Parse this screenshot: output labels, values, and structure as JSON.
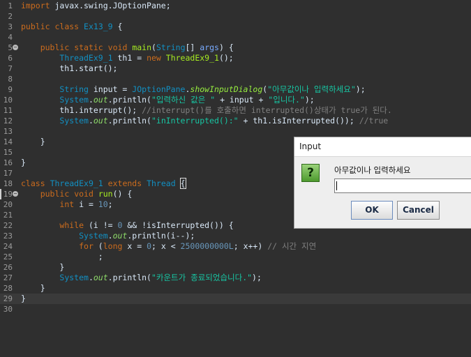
{
  "editor": {
    "lines": [
      {
        "n": "1",
        "parts": [
          {
            "t": "import",
            "c": "kw"
          },
          {
            "t": " javax.swing.JOptionPane;",
            "c": "plain"
          }
        ]
      },
      {
        "n": "2",
        "parts": []
      },
      {
        "n": "3",
        "parts": [
          {
            "t": "public",
            "c": "kw"
          },
          {
            "t": " ",
            "c": "plain"
          },
          {
            "t": "class",
            "c": "kw"
          },
          {
            "t": " ",
            "c": "plain"
          },
          {
            "t": "Ex13_9",
            "c": "cls"
          },
          {
            "t": " {",
            "c": "plain"
          }
        ]
      },
      {
        "n": "4",
        "parts": []
      },
      {
        "n": "5",
        "fold": true,
        "parts": [
          {
            "t": "    ",
            "c": "plain"
          },
          {
            "t": "public",
            "c": "kw"
          },
          {
            "t": " ",
            "c": "plain"
          },
          {
            "t": "static",
            "c": "kw"
          },
          {
            "t": " ",
            "c": "plain"
          },
          {
            "t": "void",
            "c": "kw"
          },
          {
            "t": " ",
            "c": "plain"
          },
          {
            "t": "main",
            "c": "fn"
          },
          {
            "t": "(",
            "c": "plain"
          },
          {
            "t": "String",
            "c": "ty"
          },
          {
            "t": "[] ",
            "c": "plain"
          },
          {
            "t": "args",
            "c": "param"
          },
          {
            "t": ") {",
            "c": "plain"
          }
        ]
      },
      {
        "n": "6",
        "parts": [
          {
            "t": "        ",
            "c": "plain"
          },
          {
            "t": "ThreadEx9_1",
            "c": "cls"
          },
          {
            "t": " ",
            "c": "plain"
          },
          {
            "t": "th1",
            "c": "plain"
          },
          {
            "t": " = ",
            "c": "plain"
          },
          {
            "t": "new",
            "c": "kw"
          },
          {
            "t": " ",
            "c": "plain"
          },
          {
            "t": "ThreadEx9_1",
            "c": "fn"
          },
          {
            "t": "();",
            "c": "plain"
          }
        ]
      },
      {
        "n": "7",
        "parts": [
          {
            "t": "        th1.start();",
            "c": "plain"
          }
        ]
      },
      {
        "n": "8",
        "parts": []
      },
      {
        "n": "9",
        "parts": [
          {
            "t": "        ",
            "c": "plain"
          },
          {
            "t": "String",
            "c": "ty"
          },
          {
            "t": " ",
            "c": "plain"
          },
          {
            "t": "input",
            "c": "plain"
          },
          {
            "t": " = ",
            "c": "plain"
          },
          {
            "t": "JOptionPane",
            "c": "cls"
          },
          {
            "t": ".",
            "c": "plain"
          },
          {
            "t": "showInputDialog",
            "c": "italfn"
          },
          {
            "t": "(",
            "c": "plain"
          },
          {
            "t": "\"아무값이나 입력하세요\"",
            "c": "str"
          },
          {
            "t": ");",
            "c": "plain"
          }
        ]
      },
      {
        "n": "10",
        "parts": [
          {
            "t": "        ",
            "c": "plain"
          },
          {
            "t": "System",
            "c": "ty"
          },
          {
            "t": ".",
            "c": "plain"
          },
          {
            "t": "out",
            "c": "fld"
          },
          {
            "t": ".println(",
            "c": "plain"
          },
          {
            "t": "\"입력하신 값은 \"",
            "c": "str"
          },
          {
            "t": " + input + ",
            "c": "plain"
          },
          {
            "t": "\"입니다.\"",
            "c": "str"
          },
          {
            "t": ");",
            "c": "plain"
          }
        ]
      },
      {
        "n": "11",
        "parts": [
          {
            "t": "        th1.interrupt(); ",
            "c": "plain"
          },
          {
            "t": "//interrupt()를 호출하면 interrupted()상태가 true가 된다.",
            "c": "cmt"
          }
        ]
      },
      {
        "n": "12",
        "parts": [
          {
            "t": "        ",
            "c": "plain"
          },
          {
            "t": "System",
            "c": "ty"
          },
          {
            "t": ".",
            "c": "plain"
          },
          {
            "t": "out",
            "c": "fld"
          },
          {
            "t": ".println(",
            "c": "plain"
          },
          {
            "t": "\"inInterrupted():\"",
            "c": "str"
          },
          {
            "t": " + th1.isInterrupted()); ",
            "c": "plain"
          },
          {
            "t": "//true",
            "c": "cmt"
          }
        ]
      },
      {
        "n": "13",
        "parts": []
      },
      {
        "n": "14",
        "parts": [
          {
            "t": "    }",
            "c": "plain"
          }
        ]
      },
      {
        "n": "15",
        "parts": []
      },
      {
        "n": "16",
        "parts": [
          {
            "t": "}",
            "c": "plain"
          }
        ]
      },
      {
        "n": "17",
        "parts": []
      },
      {
        "n": "18",
        "parts": [
          {
            "t": "class",
            "c": "kw"
          },
          {
            "t": " ",
            "c": "plain"
          },
          {
            "t": "ThreadEx9_1",
            "c": "cls"
          },
          {
            "t": " ",
            "c": "plain"
          },
          {
            "t": "extends",
            "c": "kw"
          },
          {
            "t": " ",
            "c": "plain"
          },
          {
            "t": "Thread",
            "c": "cls"
          },
          {
            "t": " ",
            "c": "plain"
          },
          {
            "t": "{",
            "c": "cursor"
          }
        ]
      },
      {
        "n": "19",
        "fold": true,
        "marker": true,
        "parts": [
          {
            "t": "    ",
            "c": "plain"
          },
          {
            "t": "public",
            "c": "kw"
          },
          {
            "t": " ",
            "c": "plain"
          },
          {
            "t": "void",
            "c": "kw"
          },
          {
            "t": " ",
            "c": "plain"
          },
          {
            "t": "run",
            "c": "fn"
          },
          {
            "t": "() {",
            "c": "plain"
          }
        ]
      },
      {
        "n": "20",
        "parts": [
          {
            "t": "        ",
            "c": "plain"
          },
          {
            "t": "int",
            "c": "kw"
          },
          {
            "t": " i = ",
            "c": "plain"
          },
          {
            "t": "10",
            "c": "num"
          },
          {
            "t": ";",
            "c": "plain"
          }
        ]
      },
      {
        "n": "21",
        "parts": []
      },
      {
        "n": "22",
        "parts": [
          {
            "t": "        ",
            "c": "plain"
          },
          {
            "t": "while",
            "c": "kw"
          },
          {
            "t": " (i != ",
            "c": "plain"
          },
          {
            "t": "0",
            "c": "num"
          },
          {
            "t": " && !isInterrupted()) {",
            "c": "plain"
          }
        ]
      },
      {
        "n": "23",
        "parts": [
          {
            "t": "            ",
            "c": "plain"
          },
          {
            "t": "System",
            "c": "ty"
          },
          {
            "t": ".",
            "c": "plain"
          },
          {
            "t": "out",
            "c": "fld"
          },
          {
            "t": ".println(i--);",
            "c": "plain"
          }
        ]
      },
      {
        "n": "24",
        "parts": [
          {
            "t": "            ",
            "c": "plain"
          },
          {
            "t": "for",
            "c": "kw"
          },
          {
            "t": " (",
            "c": "plain"
          },
          {
            "t": "long",
            "c": "kw"
          },
          {
            "t": " x = ",
            "c": "plain"
          },
          {
            "t": "0",
            "c": "num"
          },
          {
            "t": "; x < ",
            "c": "plain"
          },
          {
            "t": "2500000000L",
            "c": "num"
          },
          {
            "t": "; x++) ",
            "c": "plain"
          },
          {
            "t": "// 시간 지연",
            "c": "cmt"
          }
        ]
      },
      {
        "n": "25",
        "parts": [
          {
            "t": "                ;",
            "c": "plain"
          }
        ]
      },
      {
        "n": "26",
        "parts": [
          {
            "t": "        }",
            "c": "plain"
          }
        ]
      },
      {
        "n": "27",
        "parts": [
          {
            "t": "        ",
            "c": "plain"
          },
          {
            "t": "System",
            "c": "ty"
          },
          {
            "t": ".",
            "c": "plain"
          },
          {
            "t": "out",
            "c": "fld"
          },
          {
            "t": ".println(",
            "c": "plain"
          },
          {
            "t": "\"카운트가 종료되었습니다.\"",
            "c": "str"
          },
          {
            "t": ");",
            "c": "plain"
          }
        ]
      },
      {
        "n": "28",
        "parts": [
          {
            "t": "    }",
            "c": "plain"
          }
        ]
      },
      {
        "n": "29",
        "current": true,
        "parts": [
          {
            "t": "}",
            "c": "plain"
          }
        ]
      },
      {
        "n": "30",
        "parts": []
      }
    ]
  },
  "dialog": {
    "title": "Input",
    "icon": "question-icon",
    "icon_glyph": "?",
    "prompt": "아무값이나 입력하세요",
    "input_value": "",
    "ok_label": "OK",
    "cancel_label": "Cancel"
  }
}
